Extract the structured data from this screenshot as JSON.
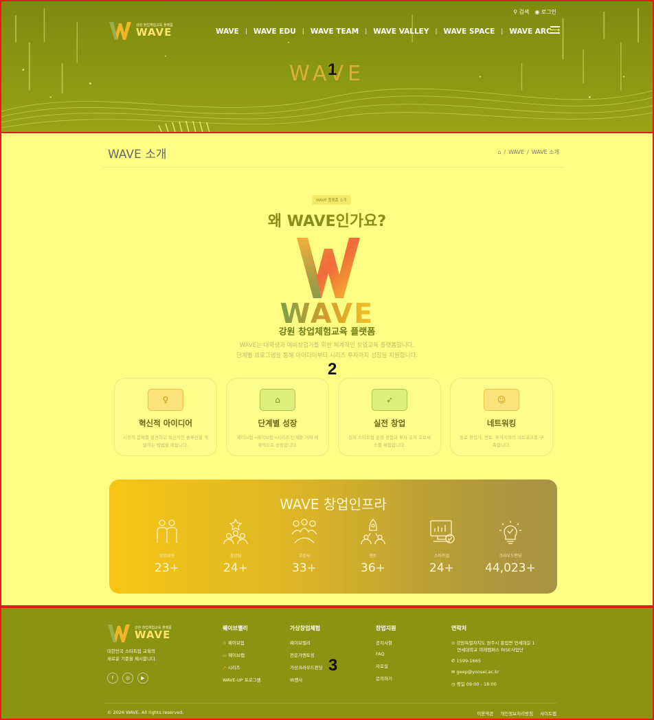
{
  "colors": {
    "accent": "#8a8d1a",
    "brand_gold": "#f3c52a",
    "footer_bg": "#8a9312",
    "main_bg": "#fefe84",
    "annotation_border": "#e31b1b"
  },
  "annotations": [
    "1",
    "2",
    "3"
  ],
  "header": {
    "logo_sub": "강원 창업체험교육 플랫폼",
    "logo_word": "WAVE",
    "search": "검색",
    "login": "로그인",
    "nav": [
      "WAVE",
      "WAVE EDU",
      "WAVE TEAM",
      "WAVE VALLEY",
      "WAVE SPACE",
      "WAVE ARC"
    ],
    "menu_icon": "hamburger-icon",
    "hero_title": "WAVE"
  },
  "page": {
    "title": "WAVE 소개",
    "breadcrumb": [
      "WAVE",
      "WAVE 소개"
    ],
    "badge": "WAVE 플랫폼 소개",
    "headline": "왜 WAVE인가요?",
    "logo_word": "WAVE",
    "subtitle": "강원 창업체험교육 플랫폼",
    "desc_line1": "WAVE는 대학생과 예비창업가를 위한 체계적인 창업교육 플랫폼입니다.",
    "desc_line2": "단계별 프로그램을 통해 아이디어부터 시리즈 투자까지 성장을 지원합니다."
  },
  "features": [
    {
      "icon": "lightbulb-icon",
      "title": "혁신적 아이디어",
      "desc": "시장의 문제를 발견하고 혁신적인 솔루션을 개발하는 방법을 배웁니다."
    },
    {
      "icon": "hierarchy-icon",
      "title": "단계별 성장",
      "desc": "웨이브업→웨이브랩→시리즈 단계를 거쳐 체계적으로 성장합니다."
    },
    {
      "icon": "rocket-icon",
      "title": "실전 창업",
      "desc": "실제 스타트업 운영 경험과 투자 유치 프로세스를 체험합니다."
    },
    {
      "icon": "people-icon",
      "title": "네트워킹",
      "desc": "동료 창업가, 멘토, 투자자와의 네트워크를 구축합니다."
    }
  ],
  "infra": {
    "title": "WAVE 창업인프라",
    "stats": [
      {
        "icon": "members-icon",
        "label": "창업회원",
        "value": "23+"
      },
      {
        "icon": "team-icon",
        "label": "창업팀",
        "value": "24+"
      },
      {
        "icon": "instructor-icon",
        "label": "교강사",
        "value": "33+"
      },
      {
        "icon": "mentor-icon",
        "label": "멘토",
        "value": "36+"
      },
      {
        "icon": "startup-icon",
        "label": "스타트업",
        "value": "24+"
      },
      {
        "icon": "crowdfunding-icon",
        "label": "크라우드펀딩",
        "value": "44,023+"
      }
    ]
  },
  "footer": {
    "logo_sub": "강원 창업체험교육 플랫폼",
    "logo_word": "WAVE",
    "slogan_line1": "대한민국 스타트업 교육의",
    "slogan_line2": "새로운 기준을 제시합니다.",
    "socials": [
      "facebook-icon",
      "instagram-icon",
      "youtube-icon"
    ],
    "columns": [
      {
        "title": "웨이브밸리",
        "items": [
          "웨이브업",
          "웨이브랩",
          "시리즈",
          "WAVE-UP 프로그램"
        ]
      },
      {
        "title": "가상창업체험",
        "items": [
          "웨이브밸리",
          "전문가멘토링",
          "가상크라우드펀딩",
          "IR행사"
        ]
      },
      {
        "title": "창업지원",
        "items": [
          "공지사항",
          "FAQ",
          "자료실",
          "문의하기"
        ]
      }
    ],
    "contact": {
      "title": "연락처",
      "address_line1": "강원특별자치도 원주시 흥업면 연세대길 1",
      "address_line2": "연세대학교 미래캠퍼스 RISE사업단",
      "phone": "1599-1665",
      "email": "geep@yonsei.ac.kr",
      "hours": "평일 09:00 - 18:00"
    },
    "copyright": "© 2026 WAVE. All rights reserved.",
    "links": [
      "이용약관",
      "개인정보처리방침",
      "사이트맵"
    ]
  }
}
